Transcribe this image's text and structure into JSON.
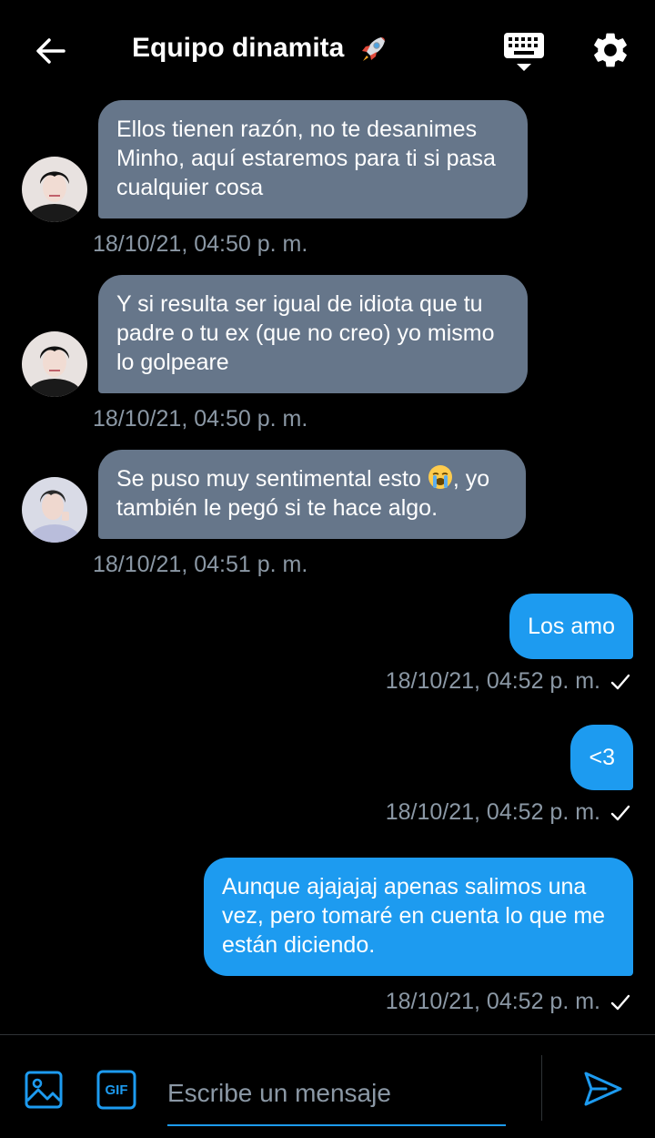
{
  "header": {
    "title": "Equipo dinamita",
    "title_emoji": "rocket",
    "icons": [
      "back-arrow-icon",
      "keyboard-icon",
      "gear-icon"
    ]
  },
  "messages": [
    {
      "direction": "incoming",
      "avatar": "avatar-minho-friend-1",
      "text": "Ellos tienen razón, no te desanimes Minho, aquí estaremos para ti si pasa cualquier cosa",
      "timestamp": "18/10/21, 04:50 p. m."
    },
    {
      "direction": "incoming",
      "avatar": "avatar-minho-friend-1",
      "text": "Y si resulta ser igual de idiota que tu padre o tu ex (que no creo) yo mismo lo golpeare",
      "timestamp": "18/10/21, 04:50 p. m."
    },
    {
      "direction": "incoming",
      "avatar": "avatar-minho-friend-2",
      "text_before_emoji": "Se puso muy sentimental esto ",
      "text_after_emoji": ", yo también le pegó si te hace algo.",
      "emoji": "loudly-crying-face",
      "timestamp": "18/10/21, 04:51 p. m."
    },
    {
      "direction": "outgoing",
      "text": "Los amo",
      "timestamp": "18/10/21, 04:52 p. m.",
      "status": "sent"
    },
    {
      "direction": "outgoing",
      "text": "<3",
      "timestamp": "18/10/21, 04:52 p. m.",
      "status": "sent"
    },
    {
      "direction": "outgoing",
      "text": "Aunque ajajajaj apenas salimos una vez, pero tomaré en cuenta lo que me están diciendo.",
      "timestamp": "18/10/21, 04:52 p. m.",
      "status": "sent"
    }
  ],
  "composer": {
    "placeholder": "Escribe un mensaje",
    "value": "",
    "gif_label": "GIF",
    "icons": [
      "image-icon",
      "gif-icon",
      "send-icon"
    ]
  },
  "colors": {
    "background": "#000000",
    "incoming_bubble": "#66768a",
    "outgoing_bubble": "#1d9bf0",
    "timestamp": "#8b98a5",
    "accent": "#1d9bf0"
  }
}
